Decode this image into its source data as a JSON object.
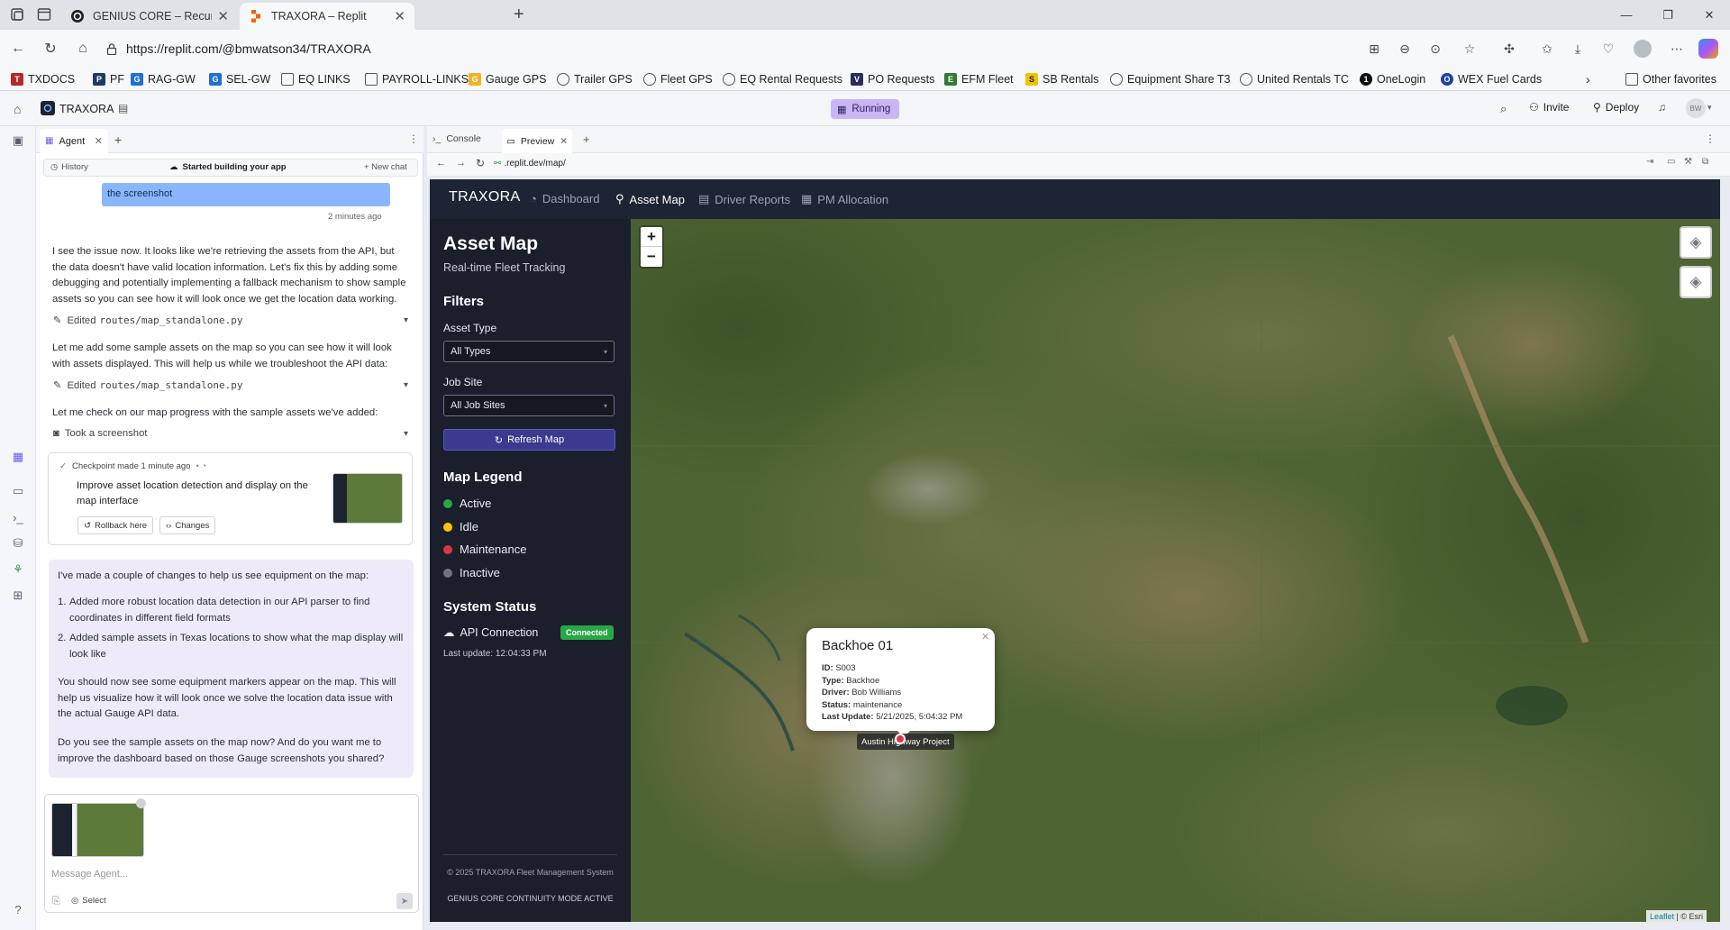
{
  "browser": {
    "tabs": [
      {
        "title": "GENIUS CORE – Recursive Cognit"
      },
      {
        "title": "TRAXORA – Replit"
      }
    ],
    "url": "https://replit.com/@bmwatson34/TRAXORA",
    "favorites": [
      "TXDOCS",
      "PF",
      "RAG-GW",
      "SEL-GW",
      "EQ LINKS",
      "PAYROLL-LINKS",
      "Gauge GPS",
      "Trailer GPS",
      "Fleet GPS",
      "EQ Rental Requests",
      "PO Requests",
      "EFM Fleet",
      "SB Rentals",
      "Equipment Share T3",
      "United Rentals TC",
      "OneLogin",
      "WEX Fuel Cards"
    ],
    "other_favorites": "Other favorites"
  },
  "replit": {
    "project_name": "TRAXORA",
    "status": "Running",
    "invite_label": "Invite",
    "deploy_label": "Deploy",
    "avatar_initials": "BW"
  },
  "agent": {
    "tab_label": "Agent",
    "history_label": "History",
    "session_title": "Started building your app",
    "new_chat_label": "+ New chat",
    "user_bubble_tail": "the screenshot",
    "timestamp": "2 minutes ago",
    "msg1": "I see the issue now. It looks like we're retrieving the assets from the API, but the data doesn't have valid location information. Let's fix this by adding some debugging and potentially implementing a fallback mechanism to show sample assets so you can see how it will look once we get the location data working.",
    "edited1_prefix": "Edited",
    "edited1_file": "routes/map_standalone.py",
    "msg2": "Let me add some sample assets on the map so you can see how it will look with assets displayed. This will help us while we troubleshoot the API data:",
    "edited2_prefix": "Edited",
    "edited2_file": "routes/map_standalone.py",
    "msg3": "Let me check on our map progress with the sample assets we've added:",
    "screenshot_label": "Took a screenshot",
    "checkpoint_label": "Checkpoint made 1 minute ago",
    "checkpoint_text": "Improve asset location detection and display on the map interface",
    "rollback_label": "Rollback here",
    "changes_label": "Changes",
    "summary_intro": "I've made a couple of changes to help us see equipment on the map:",
    "summary_items": [
      "Added more robust location data detection in our API parser to find coordinates in different field formats",
      "Added sample assets in Texas locations to show what the map display will look like"
    ],
    "summary_p2": "You should now see some equipment markers appear on the map. This will help us visualize how it will look once we solve the location data issue with the actual Gauge API data.",
    "summary_p3": "Do you see the sample assets on the map now? And do you want me to improve the dashboard based on those Gauge screenshots you shared?",
    "input_placeholder": "Message Agent...",
    "select_label": "Select"
  },
  "preview": {
    "console_tab": "Console",
    "preview_tab": "Preview",
    "url": ".replit.dev/map/"
  },
  "app": {
    "brand": "TRAXORA",
    "nav": [
      "Dashboard",
      "Asset Map",
      "Driver Reports",
      "PM Allocation"
    ],
    "page_title": "Asset Map",
    "page_subtitle": "Real-time Fleet Tracking",
    "filters_heading": "Filters",
    "asset_type_label": "Asset Type",
    "asset_type_value": "All Types",
    "job_site_label": "Job Site",
    "job_site_value": "All Job Sites",
    "refresh_label": "Refresh Map",
    "legend_heading": "Map Legend",
    "legend": [
      {
        "label": "Active",
        "color": "#28a745"
      },
      {
        "label": "Idle",
        "color": "#ffc107"
      },
      {
        "label": "Maintenance",
        "color": "#dc3545"
      },
      {
        "label": "Inactive",
        "color": "#6c757d"
      }
    ],
    "system_status_heading": "System Status",
    "api_connection_label": "API Connection",
    "connected_badge": "Connected",
    "last_update": "Last update: 12:04:33 PM",
    "footer_line1": "© 2025 TRAXORA Fleet Management System",
    "footer_line2": "GENIUS CORE CONTINUITY MODE ACTIVE"
  },
  "map": {
    "popup": {
      "title": "Backhoe 01",
      "fields": [
        {
          "key": "ID:",
          "value": "S003"
        },
        {
          "key": "Type:",
          "value": "Backhoe"
        },
        {
          "key": "Driver:",
          "value": "Bob Williams"
        },
        {
          "key": "Status:",
          "value": "maintenance"
        },
        {
          "key": "Last Update:",
          "value": "5/21/2025, 5:04:32 PM"
        }
      ]
    },
    "marker_label": "Austin Highway Project",
    "zoom_in": "+",
    "zoom_out": "−",
    "attribution_leaflet": "Leaflet",
    "attribution_esri": "| © Esri"
  },
  "colors": {
    "app_nav": "#1d2433",
    "sidebar": "#1a1f2b",
    "accent_purple": "#3b3a8f",
    "running_badge": "#c9b6f5",
    "connected_green": "#28a745"
  }
}
